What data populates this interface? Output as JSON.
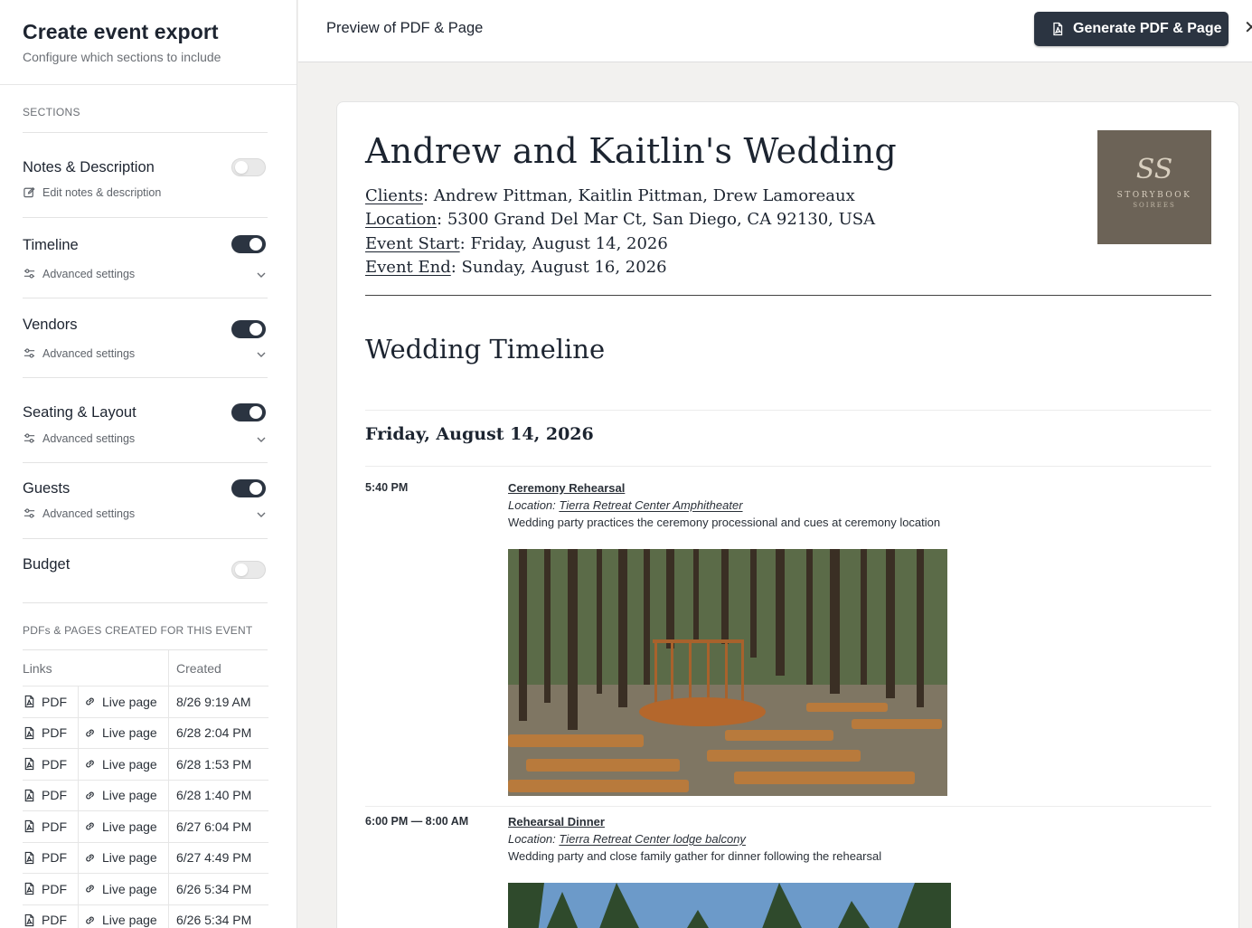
{
  "sidebar": {
    "title": "Create event export",
    "subtitle": "Configure which sections to include",
    "sections_label": "SECTIONS",
    "sections": [
      {
        "name": "Notes & Description",
        "enabled": false,
        "sub": "Edit notes & description"
      },
      {
        "name": "Timeline",
        "enabled": true,
        "sub": "Advanced settings"
      },
      {
        "name": "Vendors",
        "enabled": true,
        "sub": "Advanced settings"
      },
      {
        "name": "Seating & Layout",
        "enabled": true,
        "sub": "Advanced settings"
      },
      {
        "name": "Guests",
        "enabled": true,
        "sub": "Advanced settings"
      },
      {
        "name": "Budget",
        "enabled": false
      }
    ],
    "pdfs_label": "PDFs & PAGES CREATED FOR THIS EVENT",
    "table_headers": {
      "links": "Links",
      "created": "Created"
    },
    "pdf_rows": [
      {
        "pdf": "PDF",
        "live": "Live page",
        "created": "8/26 9:19 AM"
      },
      {
        "pdf": "PDF",
        "live": "Live page",
        "created": "6/28 2:04 PM"
      },
      {
        "pdf": "PDF",
        "live": "Live page",
        "created": "6/28 1:53 PM"
      },
      {
        "pdf": "PDF",
        "live": "Live page",
        "created": "6/28 1:40 PM"
      },
      {
        "pdf": "PDF",
        "live": "Live page",
        "created": "6/27 6:04 PM"
      },
      {
        "pdf": "PDF",
        "live": "Live page",
        "created": "6/27 4:49 PM"
      },
      {
        "pdf": "PDF",
        "live": "Live page",
        "created": "6/26 5:34 PM"
      },
      {
        "pdf": "PDF",
        "live": "Live page",
        "created": "6/26 5:34 PM"
      }
    ]
  },
  "topbar": {
    "preview_title": "Preview of PDF & Page",
    "generate_label": "Generate PDF & Page",
    "close_glyph": "✕"
  },
  "document": {
    "title": "Andrew and Kaitlin's Wedding",
    "clients_label": "Clients",
    "clients_value": ": Andrew Pittman, Kaitlin Pittman, Drew Lamoreaux",
    "location_label": "Location",
    "location_value": ": 5300 Grand Del Mar Ct, San Diego, CA 92130, USA",
    "start_label": "Event Start",
    "start_value": ": Friday, August 14, 2026",
    "end_label": "Event End",
    "end_value": ": Sunday, August 16, 2026",
    "logo": {
      "monogram": "SS",
      "name": "STORYBOOK",
      "sub": "SOIREES"
    },
    "timeline_heading": "Wedding Timeline",
    "day_heading": "Friday, August 14, 2026",
    "events": [
      {
        "time": "5:40 PM",
        "title": "Ceremony Rehearsal",
        "location_prefix": "Location: ",
        "location": "Tierra Retreat Center Amphitheater",
        "description": "Wedding party practices the ceremony processional and cues at ceremony location"
      },
      {
        "time": "6:00 PM — 8:00 AM",
        "title": "Rehearsal Dinner",
        "location_prefix": "Location: ",
        "location": "Tierra Retreat Center lodge balcony",
        "description": "Wedding party and close family gather for dinner following the rehearsal"
      }
    ]
  },
  "colors": {
    "accent": "#2b3441",
    "toggle_off": "#e9e9e9",
    "logo_bg": "#6c6357"
  }
}
